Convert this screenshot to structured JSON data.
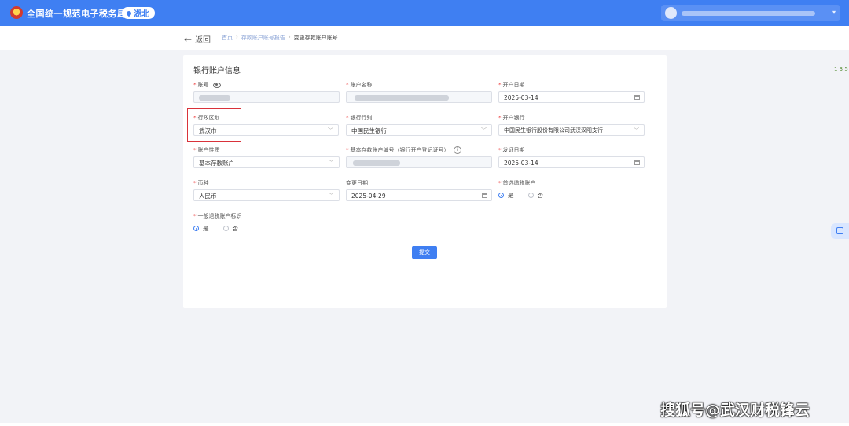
{
  "header": {
    "site_title": "全国统一规范电子税务局",
    "region": "湖北"
  },
  "nav": {
    "back_label": "返回",
    "breadcrumb": [
      "首页",
      "存款账户账号报告",
      "变更存款账户账号"
    ]
  },
  "form": {
    "section_title": "银行账户信息",
    "fields": {
      "account_no": {
        "label": "账号",
        "value": ""
      },
      "account_name": {
        "label": "账户名称",
        "value": ""
      },
      "open_date": {
        "label": "开户日期",
        "value": "2025-03-14"
      },
      "admin_region": {
        "label": "行政区划",
        "value": "武汉市"
      },
      "bank_type": {
        "label": "银行行别",
        "value": "中国民生银行"
      },
      "open_bank": {
        "label": "开户银行",
        "value": "中国民生银行股份有限公司武汉汉阳支行"
      },
      "account_nature": {
        "label": "账户性质",
        "value": "基本存款账户"
      },
      "basic_account_no": {
        "label": "基本存款账户编号（银行开户登记证号）",
        "value": ""
      },
      "issue_date": {
        "label": "发证日期",
        "value": "2025-03-14"
      },
      "currency": {
        "label": "币种",
        "value": "人民币"
      },
      "change_date": {
        "label": "变更日期",
        "value": "2025-04-29"
      },
      "preferred_tax_account": {
        "label": "首选缴税账户",
        "options": [
          "是",
          "否"
        ],
        "selected": "是"
      },
      "general_refund_flag": {
        "label": "一般退税账户标识",
        "options": [
          "是",
          "否"
        ],
        "selected": "是"
      }
    },
    "submit_label": "提交"
  },
  "side": {
    "top_badge": "1 3 5"
  },
  "watermark": "搜狐号@武汉财税锋云",
  "colors": {
    "brand": "#3f7ff2",
    "highlight": "#d9323a"
  }
}
